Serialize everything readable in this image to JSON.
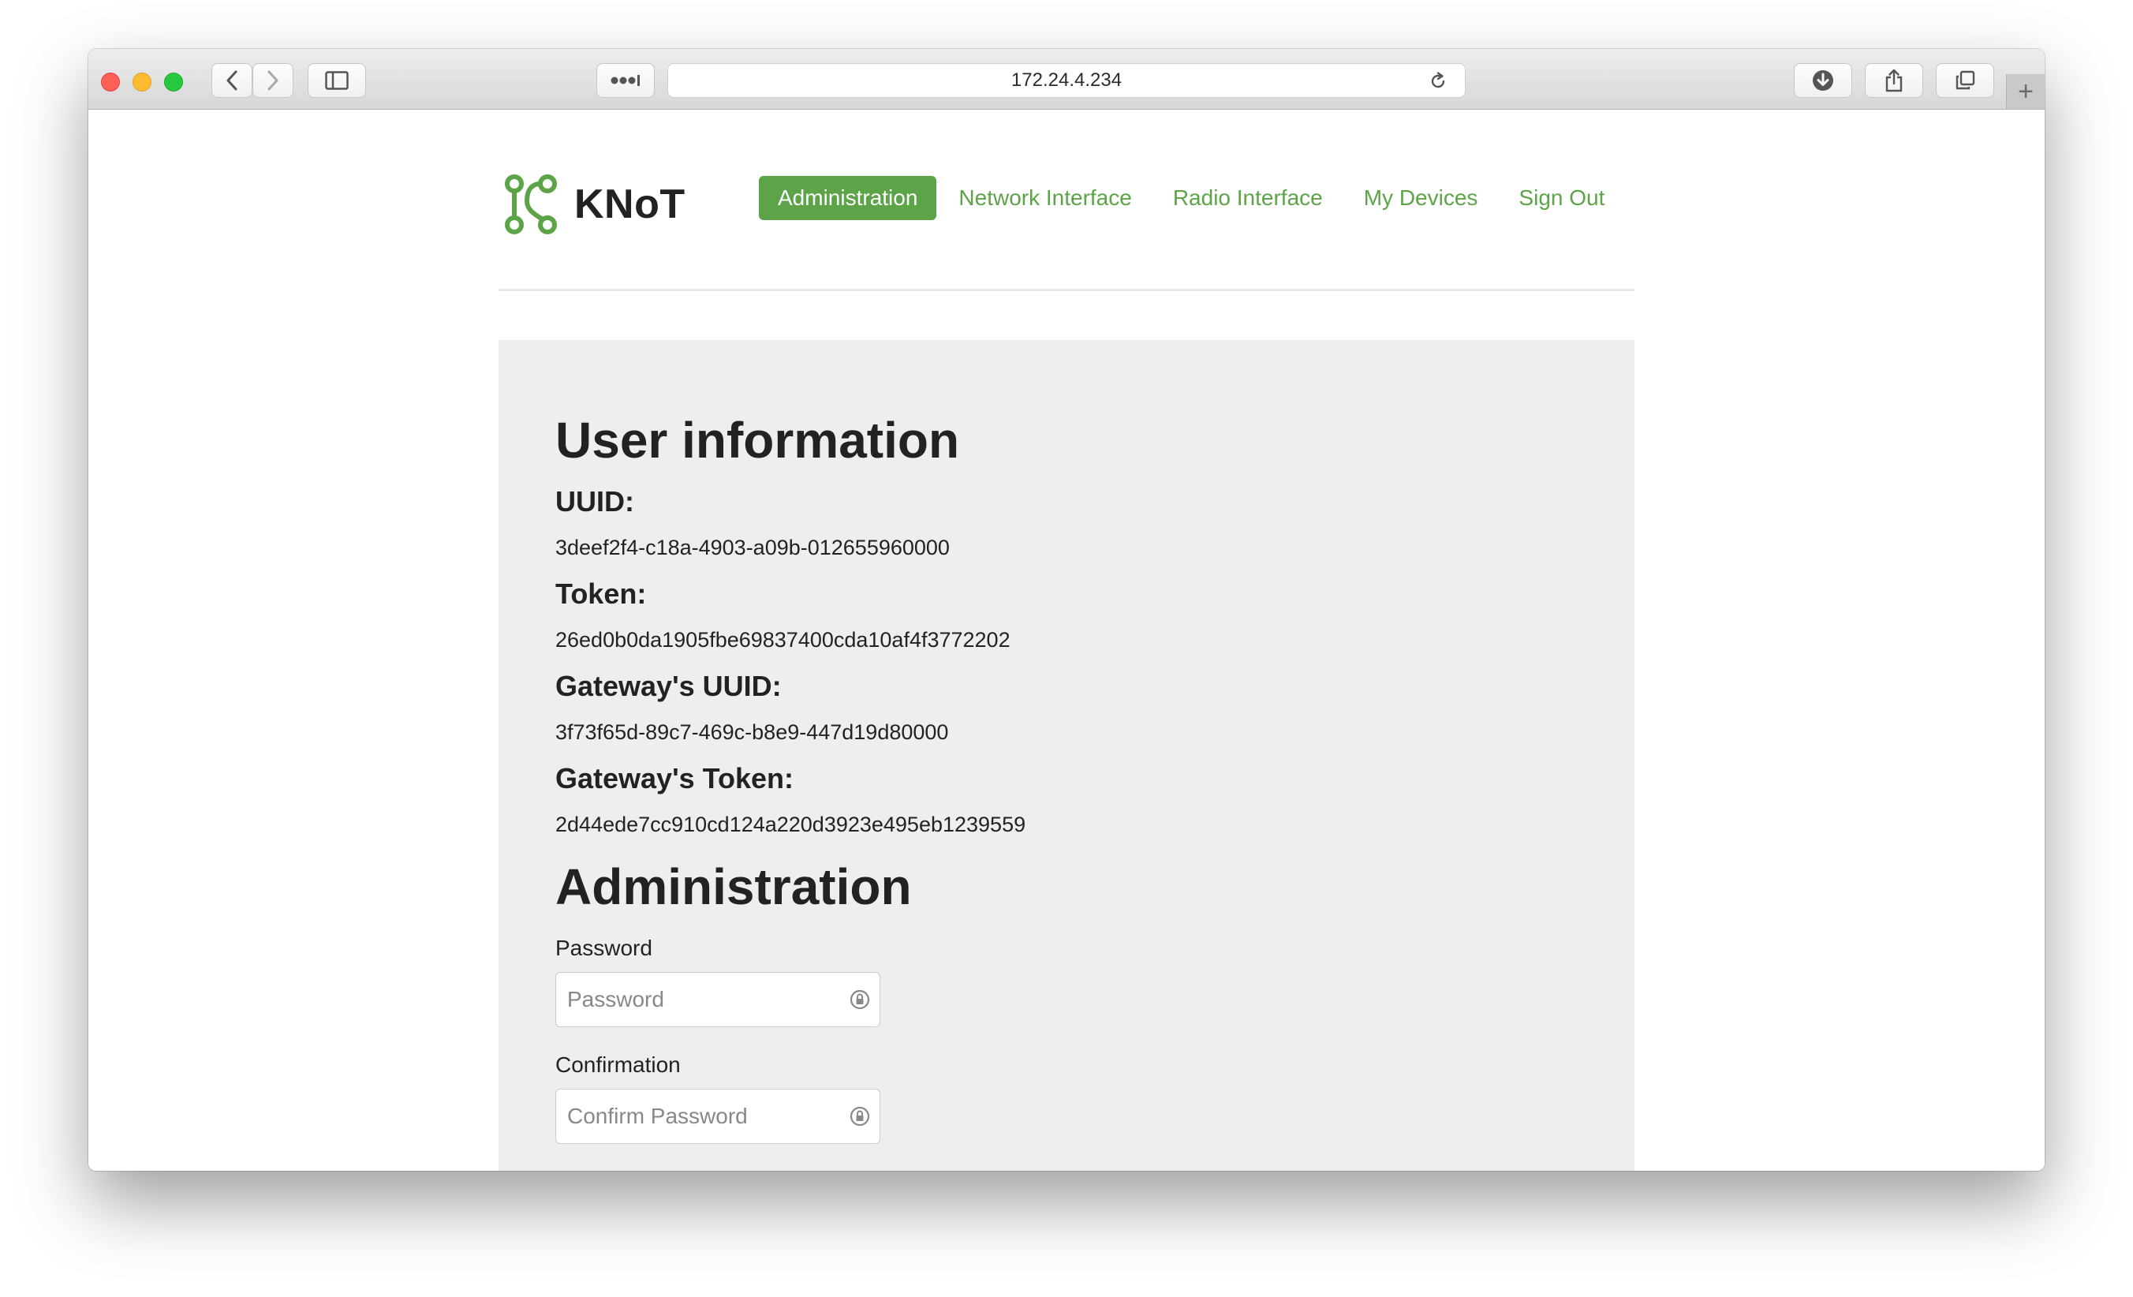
{
  "browser": {
    "url": "172.24.4.234",
    "new_tab_symbol": "+",
    "icons": [
      "back-icon",
      "forward-icon",
      "sidebar-icon",
      "extensions-icon",
      "reload-icon",
      "download-icon",
      "share-icon",
      "tabs-icon"
    ],
    "colors": {
      "close": "#fe5f57",
      "minimize": "#febc2e",
      "maximize": "#28c840"
    }
  },
  "header": {
    "brand_name": "KNoT",
    "nav": [
      {
        "label": "Administration",
        "active": true
      },
      {
        "label": "Network Interface",
        "active": false
      },
      {
        "label": "Radio Interface",
        "active": false
      },
      {
        "label": "My Devices",
        "active": false
      },
      {
        "label": "Sign Out",
        "active": false
      }
    ]
  },
  "user_info": {
    "title": "User information",
    "fields": [
      {
        "label": "UUID:",
        "value": "3deef2f4-c18a-4903-a09b-012655960000"
      },
      {
        "label": "Token:",
        "value": "26ed0b0da1905fbe69837400cda10af4f3772202"
      },
      {
        "label": "Gateway's UUID:",
        "value": "3f73f65d-89c7-469c-b8e9-447d19d80000"
      },
      {
        "label": "Gateway's Token:",
        "value": "2d44ede7cc910cd124a220d3923e495eb1239559"
      }
    ]
  },
  "administration": {
    "title": "Administration",
    "password_label": "Password",
    "password_placeholder": "Password",
    "confirmation_label": "Confirmation",
    "confirmation_placeholder": "Confirm Password"
  },
  "colors": {
    "accent": "#5ca447",
    "panel_background": "#eeeeee",
    "text": "#222222"
  }
}
